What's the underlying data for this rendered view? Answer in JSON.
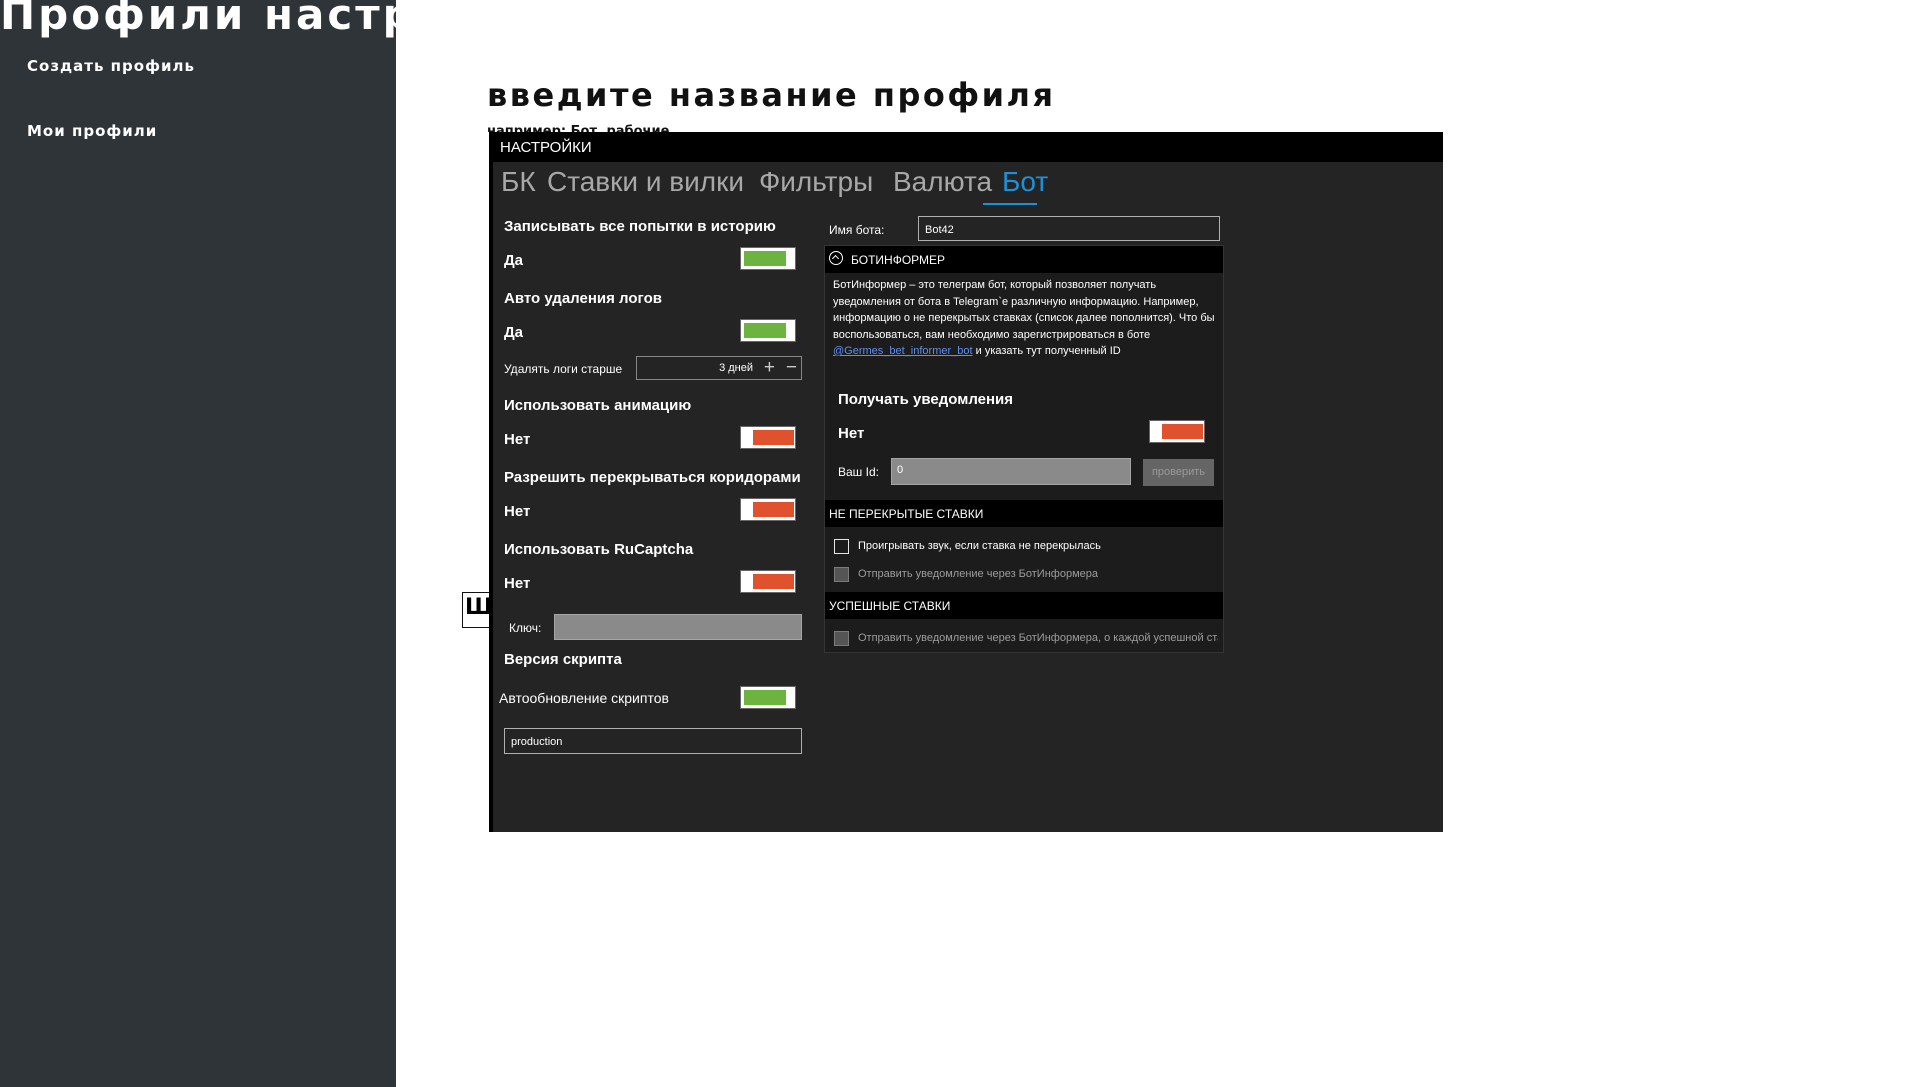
{
  "app": {
    "title": "Профили настроек"
  },
  "sidebar": {
    "create": "Создать профиль",
    "mine": "Мои профили"
  },
  "main": {
    "heading": "введите название профиля",
    "subtext": "например: Бот, рабочие",
    "side_stub": "Ш"
  },
  "window": {
    "title": "НАСТРОЙКИ",
    "tabs": [
      "БК",
      "Ставки и вилки",
      "Фильтры",
      "Валюта",
      "Бот"
    ],
    "active_tab": "Бот",
    "left": {
      "history": {
        "label": "Записывать все попытки в историю",
        "value": "Да",
        "on": true
      },
      "autodelete": {
        "label": "Авто удаления логов",
        "value": "Да",
        "on": true
      },
      "delete_older": {
        "label": "Удалять логи старше",
        "value": "3 дней",
        "plus_icon": "plus-icon",
        "minus_icon": "minus-icon"
      },
      "animation": {
        "label": "Использовать анимацию",
        "value": "Нет",
        "on": false
      },
      "overlap": {
        "label": "Разрешить перекрываться коридорами",
        "value": "Нет",
        "on": false
      },
      "rucaptcha": {
        "label": "Использовать RuCaptcha",
        "value": "Нет",
        "on": false
      },
      "key_label": "Ключ:",
      "key_value": "",
      "script_version": "Версия скрипта",
      "autoupdate": {
        "label": "Автообновление скриптов",
        "on": true
      },
      "branch": "production"
    },
    "bot": {
      "name_label": "Имя бота:",
      "name_value": "Bot42",
      "informer": {
        "title": "БОТИНФОРМЕР",
        "icon": "chevron-up-circle-icon",
        "desc_before": "БотИнформер – это телеграм бот, который позволяет получать уведомления от бота в Telegram`е различную информацию. Например, информацию о не перекрытых ставках (список далее пополнится). Что бы воспользоваться, вам необходимо зарегистрироваться в боте ",
        "link": "@Germes_bet_informer_bot",
        "desc_after": " и указать тут полученный ID",
        "notify_label": "Получать уведомления",
        "notify_value": "Нет",
        "notify_on": false,
        "id_label": "Ваш Id:",
        "id_value": "0",
        "check_button": "проверить"
      },
      "unblocked": {
        "title": "НЕ ПЕРЕКРЫТЫЕ СТАВКИ",
        "items": [
          {
            "label": "Проигрывать звук, если ставка не перекрылась",
            "checked": false,
            "enabled": true
          },
          {
            "label": "Отправить уведомление через БотИнформера",
            "checked": false,
            "enabled": false
          }
        ]
      },
      "success": {
        "title": "УСПЕШНЫЕ СТАВКИ",
        "items": [
          {
            "label": "Отправить уведомление через БотИнформера, о каждой успешной ставке",
            "checked": false,
            "enabled": false
          }
        ]
      }
    }
  },
  "colors": {
    "sidebar": "#2e3437",
    "window_bg": "#242424",
    "toggle_on": "#6db33f",
    "toggle_off": "#e0512e",
    "accent": "#1e90d6",
    "link": "#5f8fef"
  }
}
